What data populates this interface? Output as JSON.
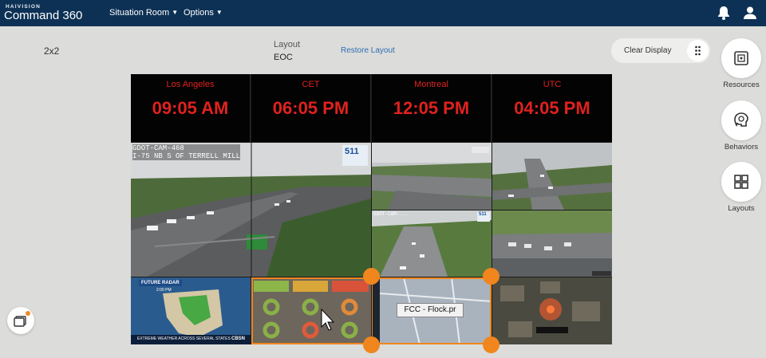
{
  "header": {
    "brand_small": "HAIVISION",
    "brand_title": "Command 360",
    "nav": [
      {
        "label": "Situation Room"
      },
      {
        "label": "Options"
      }
    ],
    "icons": [
      "bell-icon",
      "user-icon"
    ]
  },
  "layout_bar": {
    "grid": "2x2",
    "layout_caption": "Layout",
    "layout_name": "EOC",
    "restore_label": "Restore Layout",
    "clear_label": "Clear Display"
  },
  "side_panel": [
    {
      "label": "Resources",
      "icon": "resources-icon"
    },
    {
      "label": "Behaviors",
      "icon": "behaviors-icon"
    },
    {
      "label": "Layouts",
      "icon": "layouts-icon"
    }
  ],
  "clocks": [
    {
      "city": "Los Angeles",
      "time": "09:05 AM"
    },
    {
      "city": "CET",
      "time": "06:05 PM"
    },
    {
      "city": "Montreal",
      "time": "12:05 PM"
    },
    {
      "city": "UTC",
      "time": "04:05 PM"
    }
  ],
  "tiles": {
    "cam1_overlay_line1": "GDOT-CAM-468",
    "cam1_overlay_line2": "I-75 NB S OF TERRELL MILL",
    "cam2_logo": "511",
    "cam4_logo": "511",
    "cam5_overlay": "GDOT-CAM-...",
    "radar_title": "FUTURE RADAR",
    "radar_time": "2:00 PM",
    "news_ticker": "EXTREME WEATHER ACROSS SEVERAL STATES",
    "news_logo": "CBSN"
  },
  "drag": {
    "label": "FCC - Flock.pr"
  },
  "colors": {
    "topbar": "#0d3155",
    "clock_text": "#e0211f",
    "accent_orange": "#f0861d",
    "link": "#2f6db5"
  }
}
